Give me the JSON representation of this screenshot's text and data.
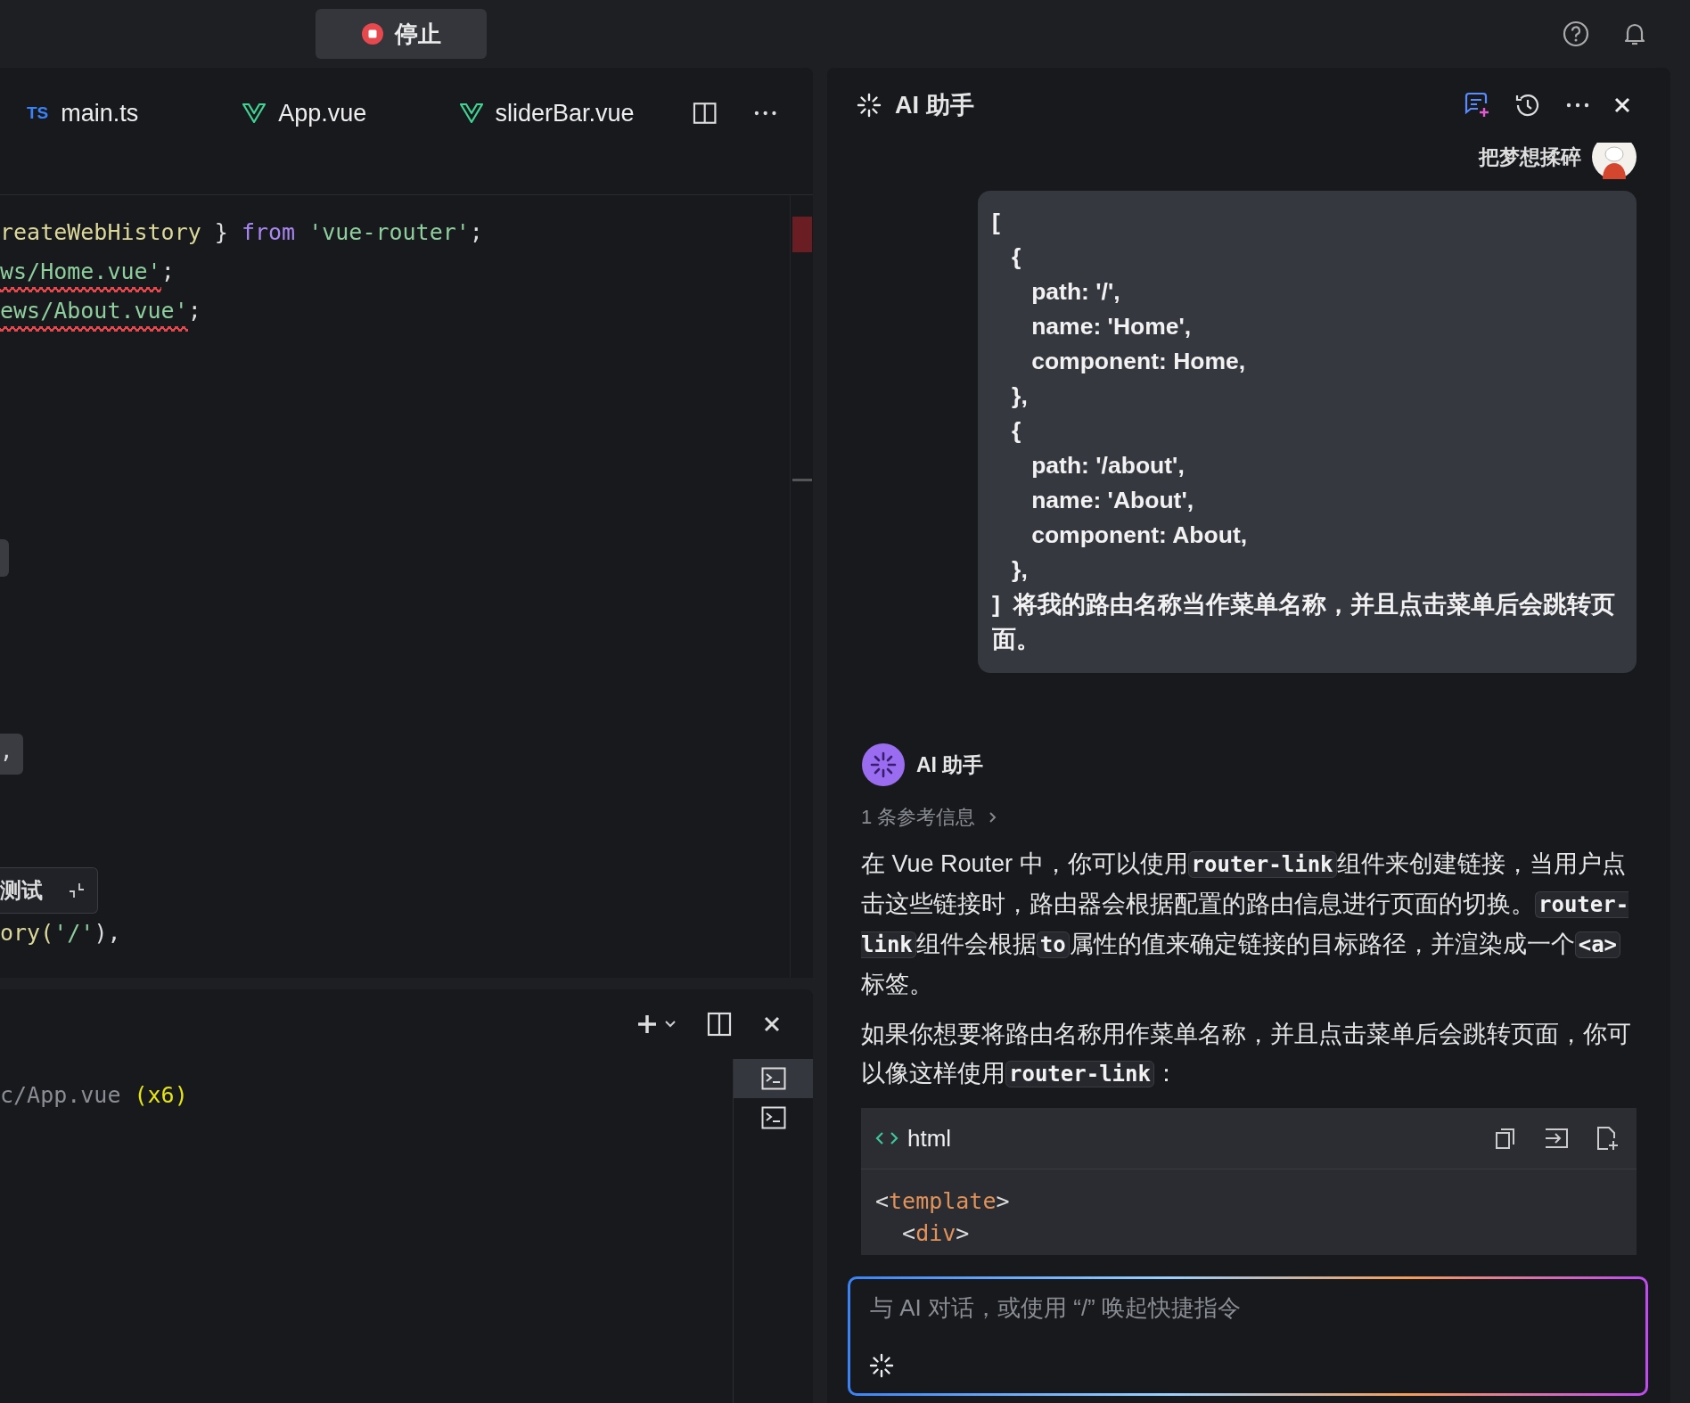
{
  "top_bar": {
    "stop_button": "停止"
  },
  "editor": {
    "tabs": [
      {
        "kind": "ts",
        "badge": "TS",
        "label": "main.ts"
      },
      {
        "kind": "vue",
        "label": "App.vue"
      },
      {
        "kind": "vue",
        "label": "sliderBar.vue"
      }
    ],
    "code_top": [
      [
        {
          "text": "reateWebHistory",
          "kind": "fn",
          "error": false
        },
        {
          "text": " } ",
          "kind": "plain",
          "error": false
        },
        {
          "text": "from ",
          "kind": "keyword",
          "error": false
        },
        {
          "text": "'vue-router'",
          "kind": "string",
          "error": false
        },
        {
          "text": ";",
          "kind": "plain",
          "error": false
        }
      ],
      [
        {
          "text": "ws/Home.vue'",
          "kind": "string",
          "error": true
        },
        {
          "text": ";",
          "kind": "plain",
          "error": false
        }
      ],
      [
        {
          "text": "ews/About.vue'",
          "kind": "string",
          "error": true
        },
        {
          "text": ";",
          "kind": "plain",
          "error": false
        }
      ]
    ],
    "peek_widget": ",",
    "tooltip": "测试",
    "code_bottom": [
      [
        {
          "text": "ory(",
          "kind": "fn",
          "error": false
        },
        {
          "text": "'/'",
          "kind": "string",
          "error": false
        },
        {
          "text": "),",
          "kind": "plain",
          "error": false
        }
      ]
    ]
  },
  "terminal": {
    "output": [
      {
        "text": "c/App.vue ",
        "kind": "path"
      },
      {
        "text": "(x6)",
        "kind": "count"
      }
    ],
    "sessions": [
      {
        "selected": true
      },
      {
        "selected": false
      }
    ]
  },
  "ai_panel": {
    "title": "AI 助手",
    "user": {
      "name": "把梦想揉碎",
      "message": "[\n   {\n      path: '/',\n      name: 'Home',\n      component: Home,\n   },\n   {\n      path: '/about',\n      name: 'About',\n      component: About,\n   },\n]  将我的路由名称当作菜单名称，并且点击菜单后会跳转页面。"
    },
    "assistant": {
      "name": "AI 助手",
      "references": "1 条参考信息",
      "paragraphs": [
        [
          {
            "text": "在 Vue Router 中，你可以使用",
            "kind": "text"
          },
          {
            "text": "router-link",
            "kind": "code"
          },
          {
            "text": "组件来创建链接，当用户点击这些链接时，路由器会根据配置的路由信息进行页面的切换。",
            "kind": "text"
          },
          {
            "text": "router-link",
            "kind": "code"
          },
          {
            "text": "组件会根据",
            "kind": "text"
          },
          {
            "text": "to",
            "kind": "code"
          },
          {
            "text": "属性的值来确定链接的目标路径，并渲染成一个",
            "kind": "text"
          },
          {
            "text": "<a>",
            "kind": "code"
          },
          {
            "text": "标签。",
            "kind": "text"
          }
        ],
        [
          {
            "text": "如果你想要将路由名称用作菜单名称，并且点击菜单后会跳转页面，你可以像这样使用",
            "kind": "text"
          },
          {
            "text": "router-link",
            "kind": "code"
          },
          {
            "text": "：",
            "kind": "text"
          }
        ]
      ],
      "code_block": {
        "language": "html",
        "lines": [
          [
            {
              "text": "<",
              "kind": "plain"
            },
            {
              "text": "template",
              "kind": "tag"
            },
            {
              "text": ">",
              "kind": "plain"
            }
          ],
          [
            {
              "text": "  <",
              "kind": "plain"
            },
            {
              "text": "div",
              "kind": "tag"
            },
            {
              "text": ">",
              "kind": "plain"
            }
          ]
        ]
      }
    },
    "input": {
      "placeholder": "与 AI 对话，或使用 “/” 唤起快捷指令"
    }
  }
}
